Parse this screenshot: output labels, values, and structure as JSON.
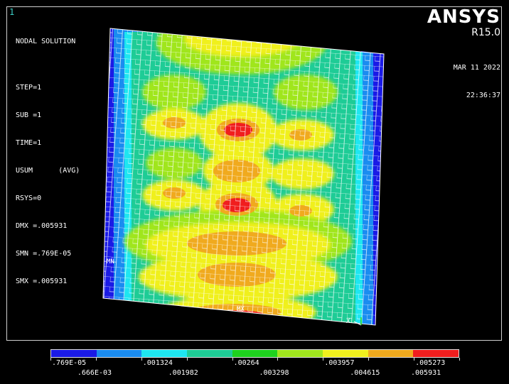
{
  "window": {
    "number": "1"
  },
  "info": {
    "lines": [
      "NODAL SOLUTION",
      "",
      "STEP=1",
      "SUB =1",
      "TIME=1",
      "USUM      (AVG)",
      "RSYS=0",
      "DMX =.005931",
      "SMN =.769E-05",
      "SMX =.005931"
    ]
  },
  "brand": {
    "logo": "ANSYS",
    "version": "R15.0"
  },
  "datetime": {
    "date": "MAR 11 2022",
    "time": "22:36:37"
  },
  "markers": {
    "min": "MN",
    "max": "MX",
    "axis": "X"
  },
  "legend": {
    "colors": [
      "#1a1ae6",
      "#1a8cf0",
      "#1ee6f0",
      "#1ecc96",
      "#1ed21e",
      "#a0e61e",
      "#f0f01e",
      "#f0aa1e",
      "#f01e1e"
    ],
    "labels_top_row": [
      ".769E-05",
      ".001324",
      ".00264",
      ".003957",
      ".005273"
    ],
    "labels_bottom_row": [
      ".666E-03",
      ".001982",
      ".003298",
      ".004615",
      ".005931"
    ]
  }
}
